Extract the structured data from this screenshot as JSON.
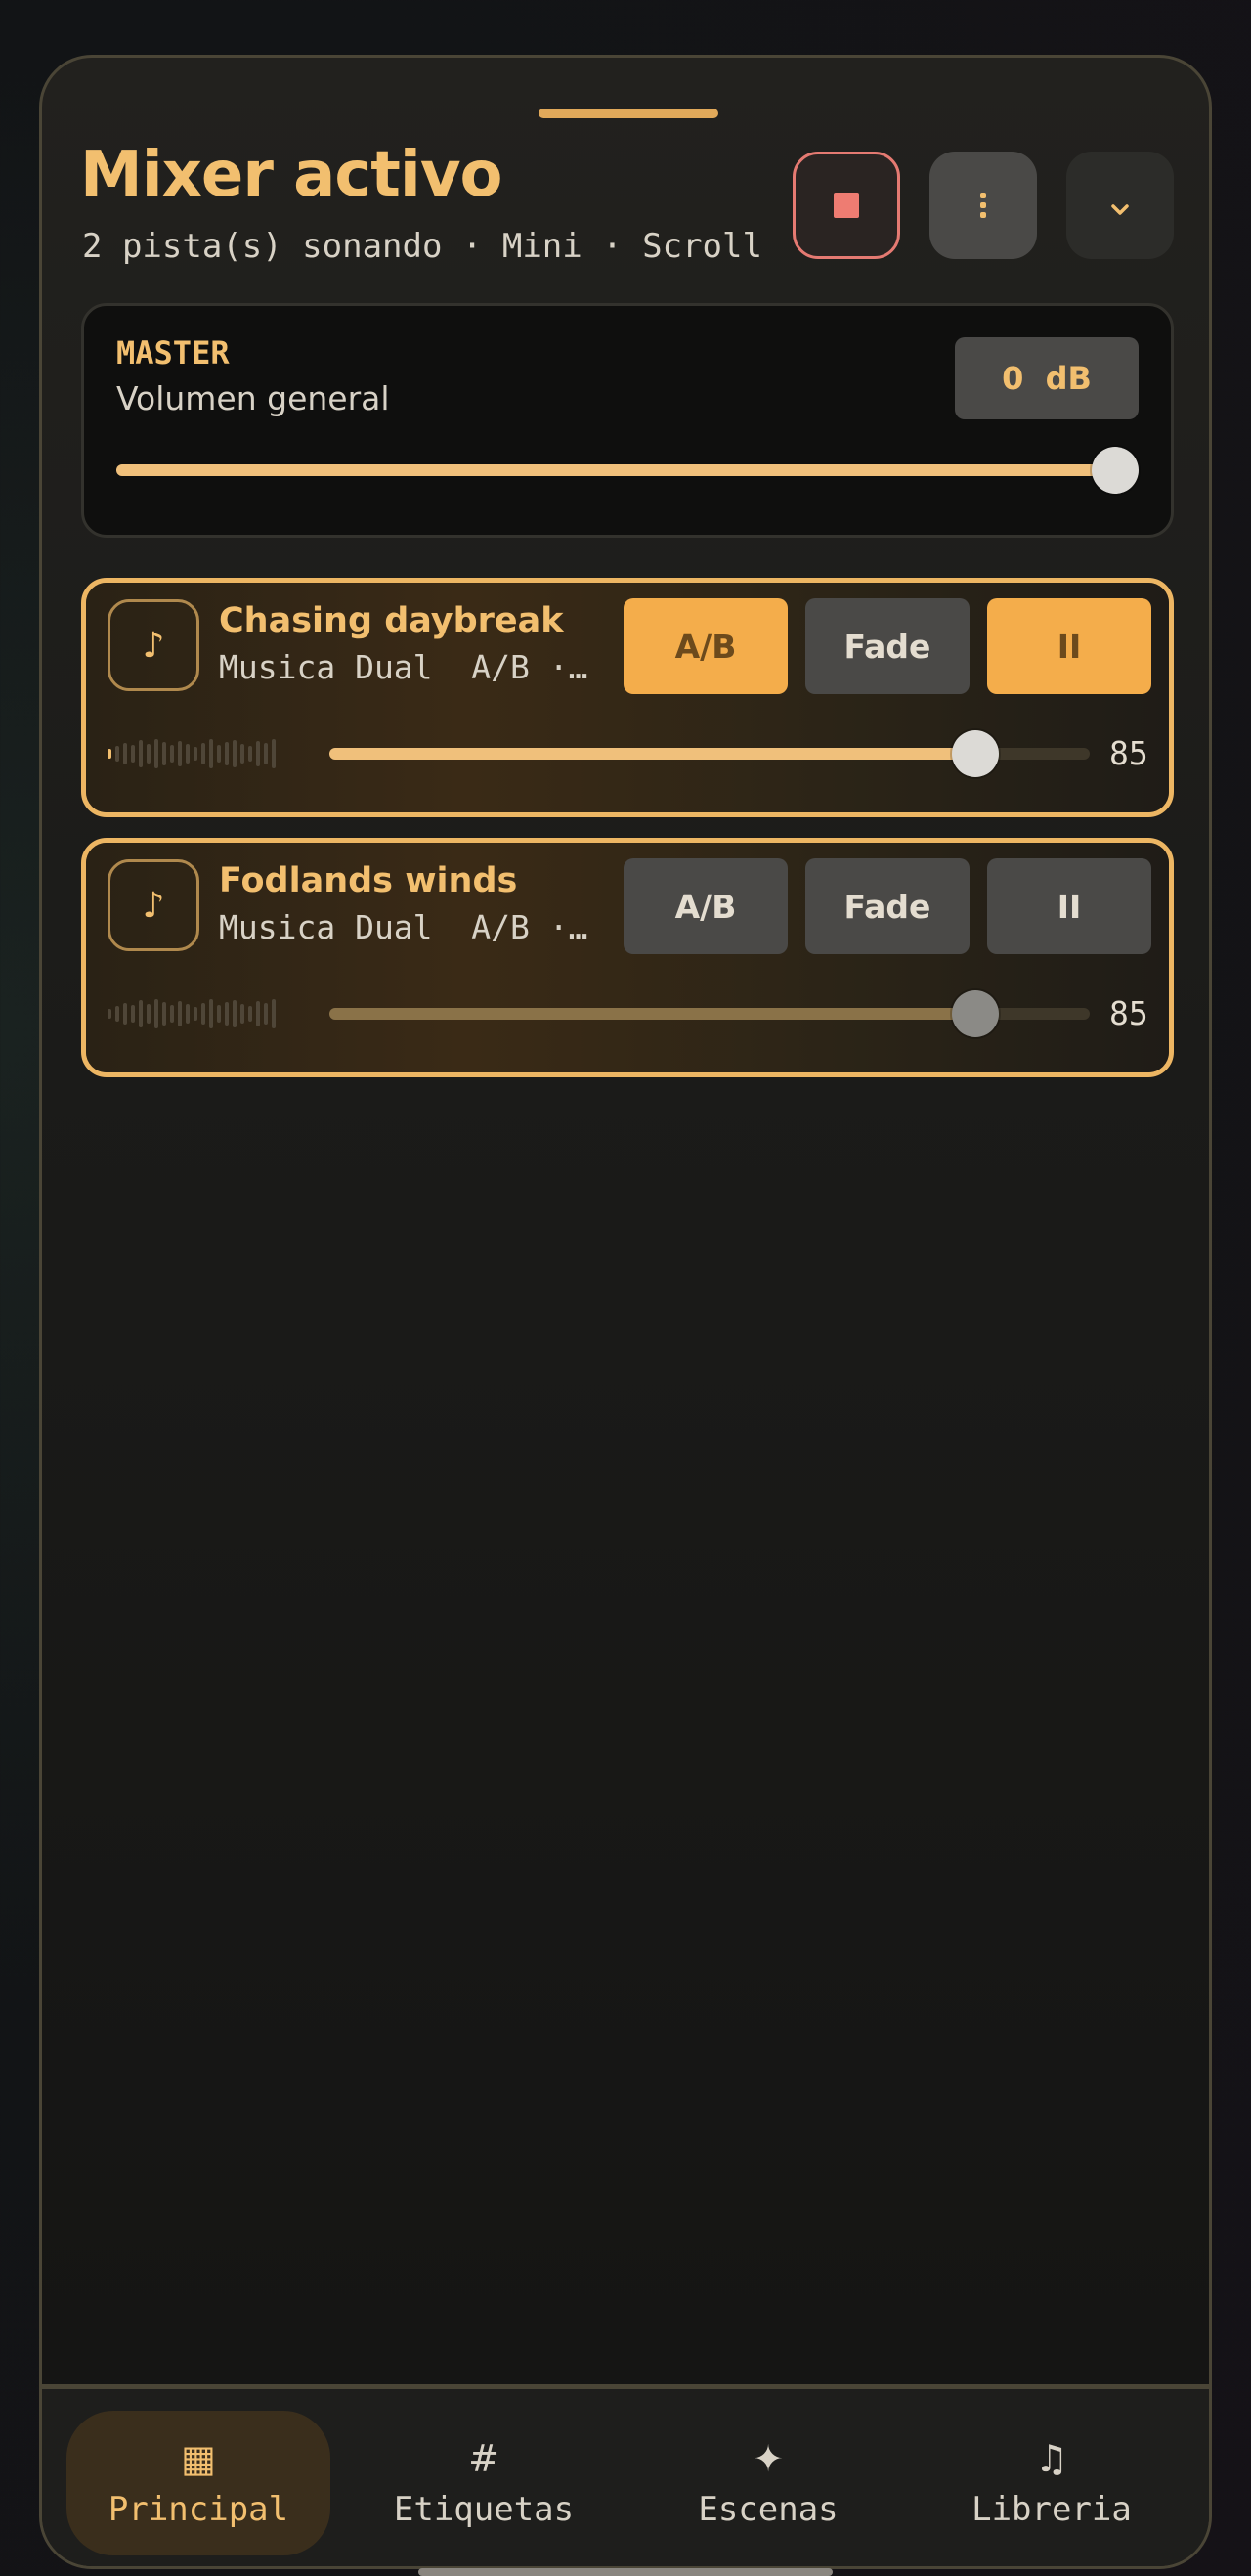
{
  "header": {
    "title": "Mixer activo",
    "subtitle": "2 pista(s) sonando · Mini · Scroll",
    "stop_icon": "stop-icon",
    "more_icon": "more-vertical-icon",
    "collapse_icon": "chevron-down-icon"
  },
  "master": {
    "label": "MASTER",
    "description": "Volumen general",
    "db": "0  dB",
    "level": 1.0
  },
  "tracks": [
    {
      "title": "Chasing daybreak",
      "subtitle": "Musica Dual  A/B ·…",
      "icon": "music-note-icon",
      "buttons": {
        "ab": "A/B",
        "fade": "Fade",
        "pause": "II"
      },
      "ab_active": true,
      "pause_active": true,
      "volume": "85",
      "volume_level": 0.85
    },
    {
      "title": "Fodlands winds",
      "subtitle": "Musica Dual  A/B ·…",
      "icon": "music-note-icon",
      "buttons": {
        "ab": "A/B",
        "fade": "Fade",
        "pause": "II"
      },
      "ab_active": false,
      "pause_active": false,
      "volume": "85",
      "volume_level": 0.85
    }
  ],
  "nav": {
    "items": [
      {
        "label": "Principal",
        "icon": "▦",
        "icon_name": "grid-icon",
        "active": true
      },
      {
        "label": "Etiquetas",
        "icon": "#",
        "icon_name": "hash-icon",
        "active": false
      },
      {
        "label": "Escenas",
        "icon": "✦",
        "icon_name": "sparkle-icon",
        "active": false
      },
      {
        "label": "Libreria",
        "icon": "♫",
        "icon_name": "music-library-icon",
        "active": false
      }
    ]
  },
  "colors": {
    "accent": "#f2bf6f",
    "stop": "#ee7c72",
    "button_active": "#f4ad4b"
  }
}
